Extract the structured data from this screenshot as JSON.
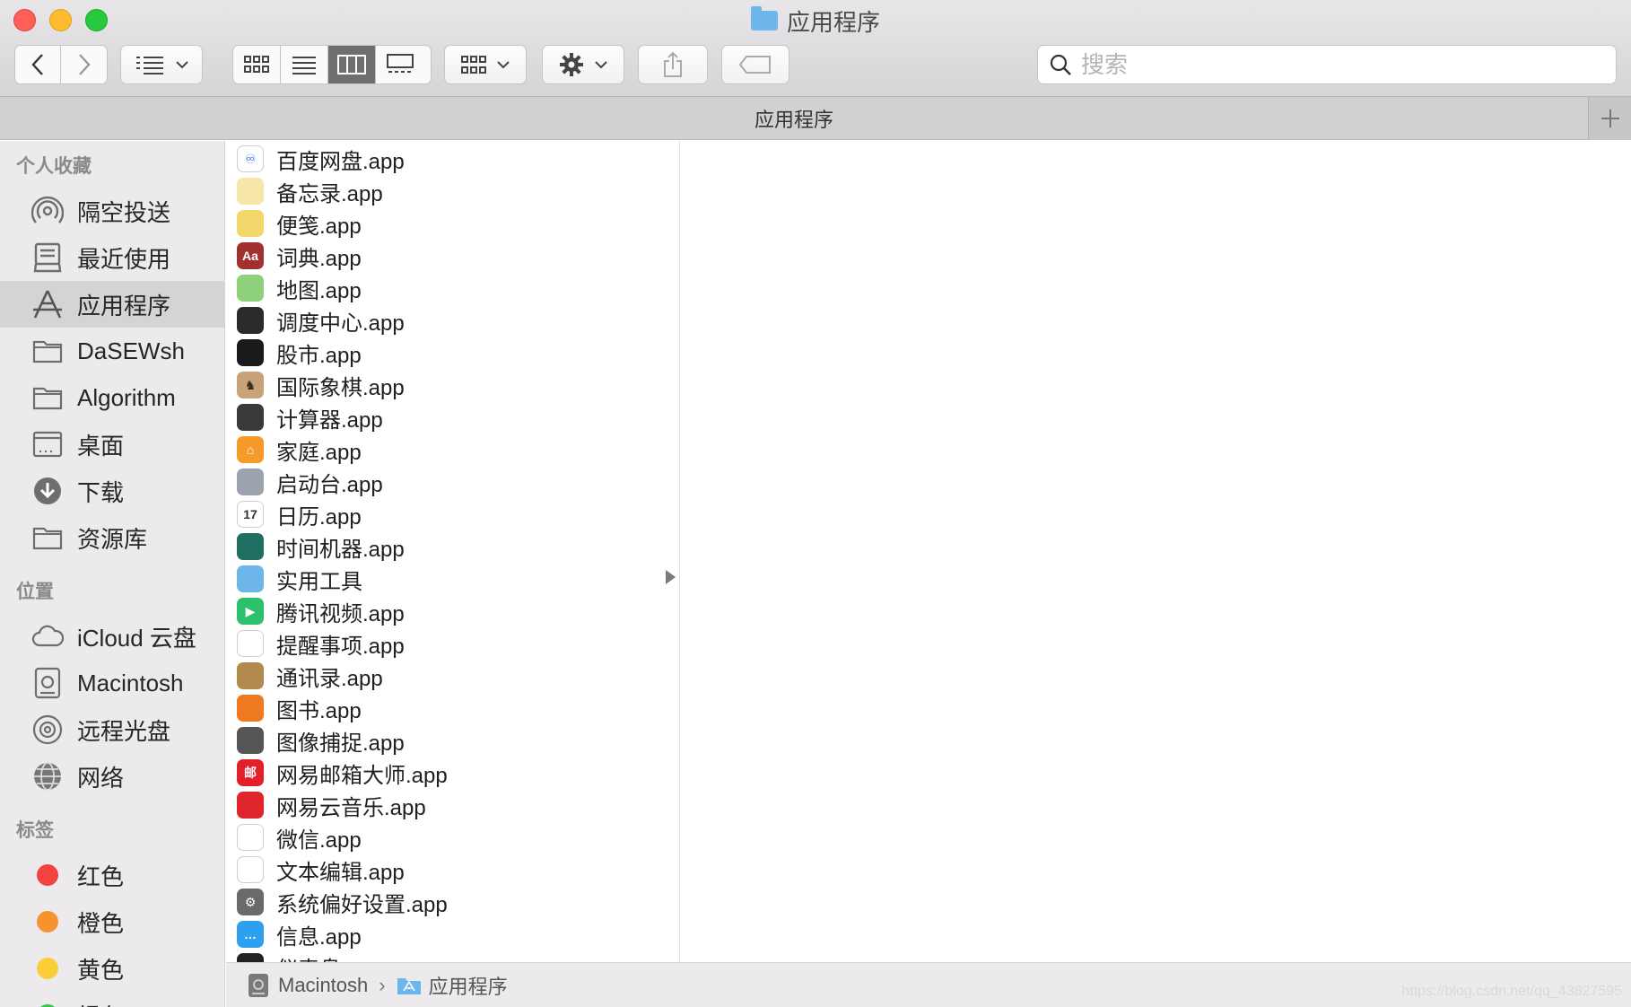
{
  "window": {
    "title": "应用程序"
  },
  "toolbar": {
    "search_placeholder": "搜索"
  },
  "tab": {
    "label": "应用程序"
  },
  "sidebar": {
    "favorites_heading": "个人收藏",
    "favorites": [
      {
        "label": "隔空投送",
        "icon": "airdrop-icon"
      },
      {
        "label": "最近使用",
        "icon": "recents-icon"
      },
      {
        "label": "应用程序",
        "icon": "applications-icon"
      },
      {
        "label": "DaSEWsh",
        "icon": "folder-icon"
      },
      {
        "label": "Algorithm",
        "icon": "folder-icon"
      },
      {
        "label": "桌面",
        "icon": "desktop-icon"
      },
      {
        "label": "下载",
        "icon": "downloads-icon"
      },
      {
        "label": "资源库",
        "icon": "folder-icon"
      }
    ],
    "locations_heading": "位置",
    "locations": [
      {
        "label": "iCloud 云盘",
        "icon": "cloud-icon"
      },
      {
        "label": "Macintosh",
        "icon": "harddisk-icon"
      },
      {
        "label": "远程光盘",
        "icon": "disc-icon"
      },
      {
        "label": "网络",
        "icon": "network-icon"
      }
    ],
    "tags_heading": "标签",
    "tags": [
      {
        "label": "红色",
        "color": "#f1443e"
      },
      {
        "label": "橙色",
        "color": "#f7932e"
      },
      {
        "label": "黄色",
        "color": "#fbcd37"
      },
      {
        "label": "绿色",
        "color": "#34c74a"
      }
    ]
  },
  "files": [
    {
      "name": "百度网盘.app",
      "color": "#ffffff",
      "glyph": "♾",
      "fg": "#2a6be6"
    },
    {
      "name": "备忘录.app",
      "color": "#f6e7a8",
      "glyph": "",
      "fg": "#000"
    },
    {
      "name": "便笺.app",
      "color": "#f3d76a",
      "glyph": "",
      "fg": "#000"
    },
    {
      "name": "词典.app",
      "color": "#a1312f",
      "glyph": "Aa",
      "fg": "#fff"
    },
    {
      "name": "地图.app",
      "color": "#8fd17a",
      "glyph": "",
      "fg": "#000"
    },
    {
      "name": "调度中心.app",
      "color": "#2b2b2b",
      "glyph": "",
      "fg": "#fff"
    },
    {
      "name": "股市.app",
      "color": "#1a1a1a",
      "glyph": "",
      "fg": "#fff"
    },
    {
      "name": "国际象棋.app",
      "color": "#c9a27a",
      "glyph": "♞",
      "fg": "#3b2a1a"
    },
    {
      "name": "计算器.app",
      "color": "#3a3a3a",
      "glyph": "",
      "fg": "#fff"
    },
    {
      "name": "家庭.app",
      "color": "#f59a2b",
      "glyph": "⌂",
      "fg": "#fff"
    },
    {
      "name": "启动台.app",
      "color": "#9aa3ad",
      "glyph": "",
      "fg": "#fff"
    },
    {
      "name": "日历.app",
      "color": "#ffffff",
      "glyph": "17",
      "fg": "#333"
    },
    {
      "name": "时间机器.app",
      "color": "#1f6e62",
      "glyph": "",
      "fg": "#fff"
    },
    {
      "name": "实用工具",
      "color": "#6cb6ea",
      "glyph": "",
      "fg": "#fff",
      "folder": true
    },
    {
      "name": "腾讯视频.app",
      "color": "#2dbf6b",
      "glyph": "▶",
      "fg": "#fff"
    },
    {
      "name": "提醒事项.app",
      "color": "#ffffff",
      "glyph": "",
      "fg": "#333"
    },
    {
      "name": "通讯录.app",
      "color": "#b38a4d",
      "glyph": "",
      "fg": "#fff"
    },
    {
      "name": "图书.app",
      "color": "#f07a1f",
      "glyph": "",
      "fg": "#fff"
    },
    {
      "name": "图像捕捉.app",
      "color": "#555555",
      "glyph": "",
      "fg": "#fff"
    },
    {
      "name": "网易邮箱大师.app",
      "color": "#e3202a",
      "glyph": "邮",
      "fg": "#fff"
    },
    {
      "name": "网易云音乐.app",
      "color": "#e1252d",
      "glyph": "",
      "fg": "#fff"
    },
    {
      "name": "微信.app",
      "color": "#ffffff",
      "glyph": "",
      "fg": "#333"
    },
    {
      "name": "文本编辑.app",
      "color": "#ffffff",
      "glyph": "",
      "fg": "#333"
    },
    {
      "name": "系统偏好设置.app",
      "color": "#6a6a6a",
      "glyph": "⚙",
      "fg": "#fff"
    },
    {
      "name": "信息.app",
      "color": "#2fa0f0",
      "glyph": "…",
      "fg": "#fff"
    },
    {
      "name": "仪表盘.app",
      "color": "#222222",
      "glyph": "",
      "fg": "#fff"
    }
  ],
  "pathbar": {
    "items": [
      {
        "label": "Macintosh",
        "icon": "harddisk-icon"
      },
      {
        "label": "应用程序",
        "icon": "folder-icon"
      }
    ]
  },
  "watermark": "https://blog.csdn.net/qq_43827595"
}
